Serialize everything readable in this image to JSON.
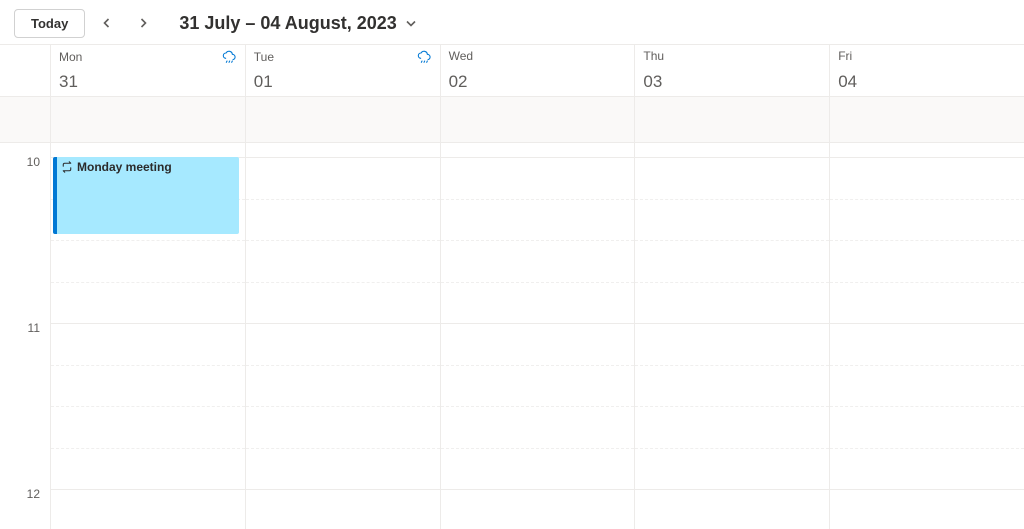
{
  "toolbar": {
    "today_label": "Today",
    "date_range": "31 July – 04 August, 2023"
  },
  "days": [
    {
      "dow": "Mon",
      "date": "31",
      "weather": true
    },
    {
      "dow": "Tue",
      "date": "01",
      "weather": true
    },
    {
      "dow": "Wed",
      "date": "02",
      "weather": false
    },
    {
      "dow": "Thu",
      "date": "03",
      "weather": false
    },
    {
      "dow": "Fri",
      "date": "04",
      "weather": false
    }
  ],
  "hours": [
    "10",
    "11",
    "12"
  ],
  "events": [
    {
      "title": "Monday meeting",
      "day_index": 0,
      "start_hour_index": 0,
      "duration_halfhours": 1
    }
  ]
}
